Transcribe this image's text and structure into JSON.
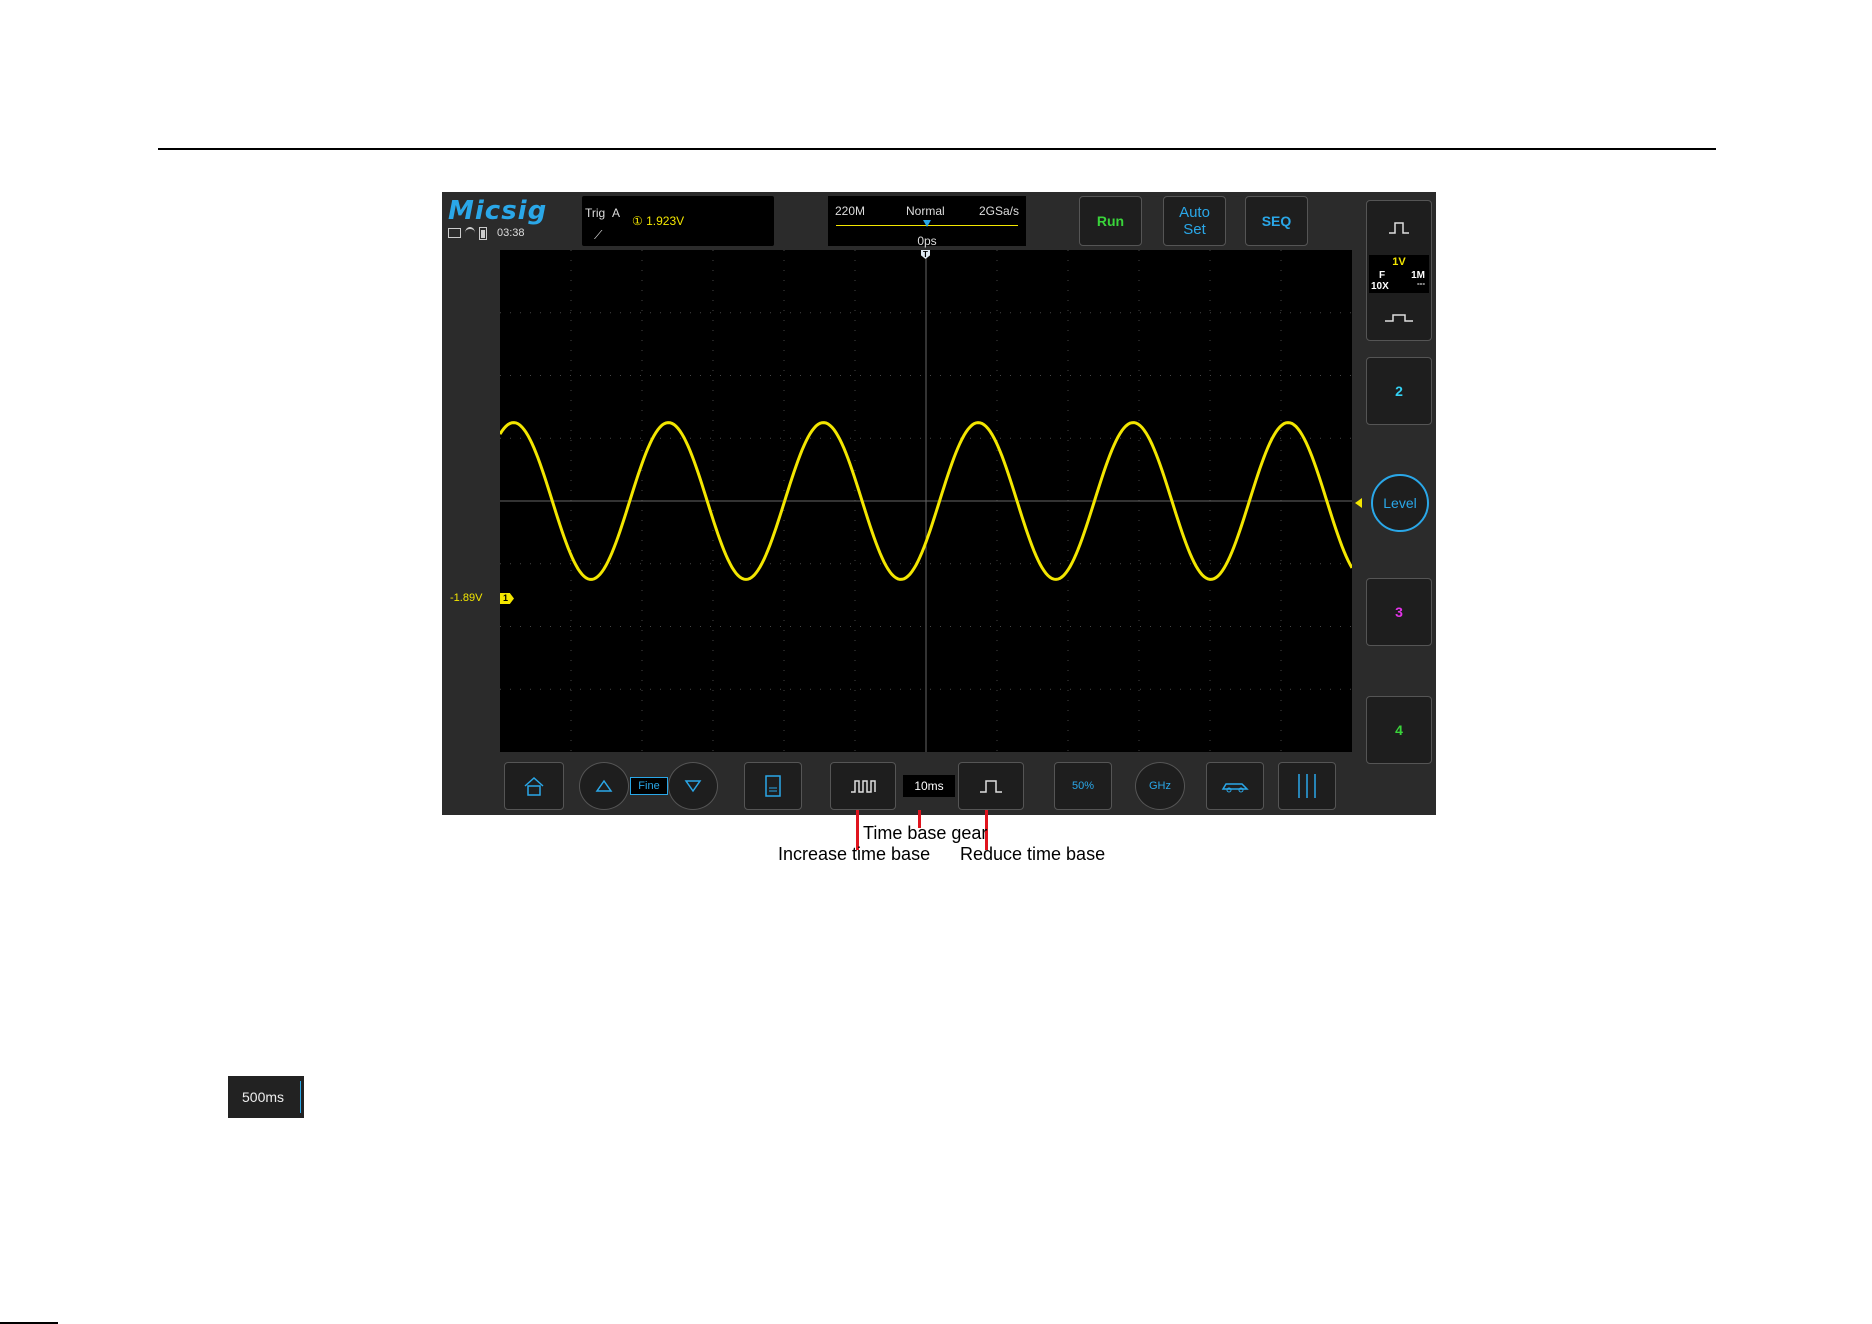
{
  "brand": {
    "logo": "Micsig",
    "clock": "03:38"
  },
  "trigger": {
    "label": "Trig",
    "source": "A",
    "channel_badge": "①",
    "level": "1.923V"
  },
  "timebase_panel": {
    "memory_depth": "220M",
    "mode": "Normal",
    "sample_rate": "2GSa/s",
    "position": "0ps"
  },
  "top_buttons": {
    "run": "Run",
    "auto_line1": "Auto",
    "auto_line2": "Set",
    "seq": "SEQ"
  },
  "channel1": {
    "scale": "1V",
    "coupling": "F",
    "probe": "10X",
    "impedance": "1M",
    "dc_symbol": "---",
    "offset_label": "-1.89V",
    "marker": "1"
  },
  "channels": {
    "ch2": "2",
    "ch3": "3",
    "ch4": "4"
  },
  "level_knob": "Level",
  "trigger_position_marker": "T",
  "bottom": {
    "fine_label": "Fine",
    "timebase_gear": "10ms",
    "half_button": "50%",
    "ghz_button": "GHz"
  },
  "callouts": {
    "gear": "Time base gear",
    "increase": "Increase time base",
    "reduce": "Reduce time base"
  },
  "thumbnail": {
    "value": "500ms"
  },
  "colors": {
    "ch1": "#f3e600",
    "ch2": "#33d0f2",
    "ch3": "#e233e8",
    "ch4": "#39d33a",
    "accent": "#2aa7e8",
    "run": "#39d33a",
    "callout_line": "#e0141e"
  },
  "waveform": {
    "channel": 1,
    "shape": "sine",
    "periods_on_screen": 5.5
  }
}
